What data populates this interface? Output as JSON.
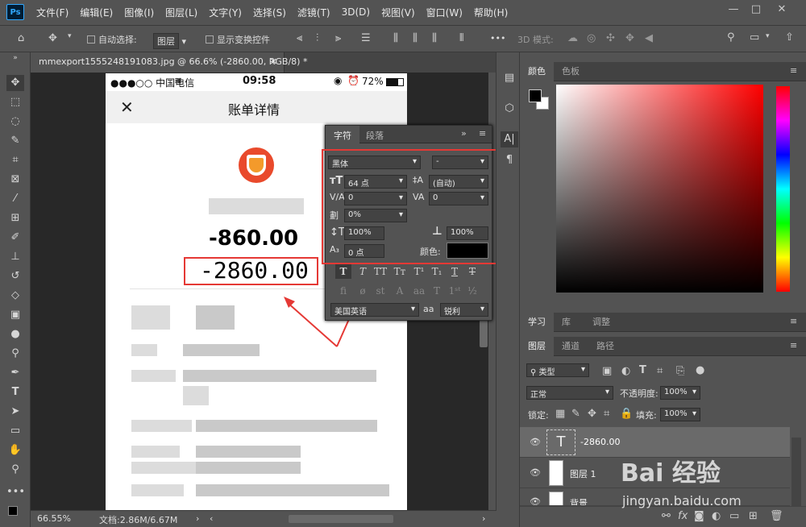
{
  "app": {
    "logo": "Ps"
  },
  "menu": [
    "文件(F)",
    "编辑(E)",
    "图像(I)",
    "图层(L)",
    "文字(Y)",
    "选择(S)",
    "滤镜(T)",
    "3D(D)",
    "视图(V)",
    "窗口(W)",
    "帮助(H)"
  ],
  "options": {
    "auto_select_label": "自动选择:",
    "auto_select_value": "图层",
    "show_transform_label": "显示变换控件",
    "mode_3d_label": "3D 模式:",
    "more": "•••"
  },
  "document": {
    "tab_title": "mmexport1555248191083.jpg @ 66.6% (-2860.00, RGB/8) *"
  },
  "phone": {
    "carrier": "●●●○○ 中国电信",
    "time": "09:58",
    "battery": "72%",
    "close": "✕",
    "title": "账单详情",
    "amount1": "-860.00",
    "amount2": "-2860.00"
  },
  "character_panel": {
    "tab_char": "字符",
    "tab_para": "段落",
    "font_family": "黑体",
    "font_style": "-",
    "font_size": "64 点",
    "leading": "(自动)",
    "kerning": "0",
    "tracking": "0",
    "scale_tsume": "0%",
    "vertical_scale": "100%",
    "horizontal_scale": "100%",
    "baseline_shift": "0 点",
    "color_label": "颜色:",
    "language": "美国英语",
    "antialias_label": "aa",
    "antialias": "锐利"
  },
  "colors": {
    "text_color": "#000000",
    "highlight": "#e53935"
  },
  "color_panel": {
    "tab_color": "颜色",
    "tab_swatches": "色板"
  },
  "mid_panel": {
    "tab_learn": "学习",
    "tab_library": "库",
    "tab_adjust": "调整"
  },
  "layers_panel": {
    "tab_layers": "图层",
    "tab_channels": "通道",
    "tab_paths": "路径",
    "filter_kind": "类型",
    "blend_mode": "正常",
    "opacity_label": "不透明度:",
    "opacity": "100%",
    "lock_label": "锁定:",
    "fill_label": "填充:",
    "fill": "100%",
    "layers": [
      {
        "name": "-2860.00",
        "type": "T"
      },
      {
        "name": "图层 1",
        "type": ""
      },
      {
        "name": "背景",
        "type": ""
      }
    ]
  },
  "status": {
    "zoom": "66.55%",
    "doc": "文档:2.86M/6.67M"
  },
  "watermark": {
    "brand": "Bai 经验",
    "url": "jingyan.baidu.com"
  }
}
